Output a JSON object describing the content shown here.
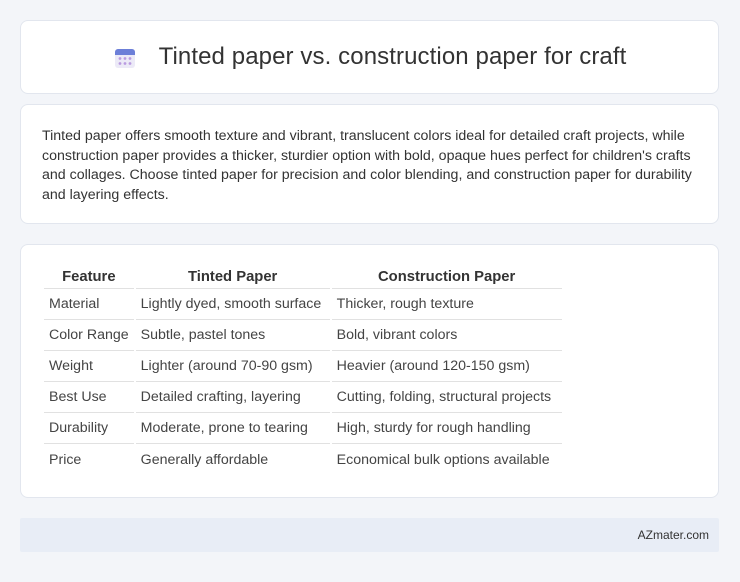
{
  "header": {
    "icon": "calendar-icon",
    "title": "Tinted paper vs. construction paper for craft"
  },
  "summary": {
    "text": "Tinted paper offers smooth texture and vibrant, translucent colors ideal for detailed craft projects, while construction paper provides a thicker, sturdier option with bold, opaque hues perfect for children's crafts and collages. Choose tinted paper for precision and color blending, and construction paper for durability and layering effects."
  },
  "table": {
    "headers": [
      "Feature",
      "Tinted Paper",
      "Construction Paper"
    ],
    "rows": [
      [
        "Material",
        "Lightly dyed, smooth surface",
        "Thicker, rough texture"
      ],
      [
        "Color Range",
        "Subtle, pastel tones",
        "Bold, vibrant colors"
      ],
      [
        "Weight",
        "Lighter (around 70-90 gsm)",
        "Heavier (around 120-150 gsm)"
      ],
      [
        "Best Use",
        "Detailed crafting, layering",
        "Cutting, folding, structural projects"
      ],
      [
        "Durability",
        "Moderate, prone to tearing",
        "High, sturdy for rough handling"
      ],
      [
        "Price",
        "Generally affordable",
        "Economical bulk options available"
      ]
    ]
  },
  "footer": {
    "brand": "AZmater.com"
  },
  "colors": {
    "background": "#f3f5f9",
    "card": "#ffffff",
    "footer": "#e8edf6",
    "icon_top": "#6c7fd8",
    "icon_grid": "#b99be0"
  }
}
